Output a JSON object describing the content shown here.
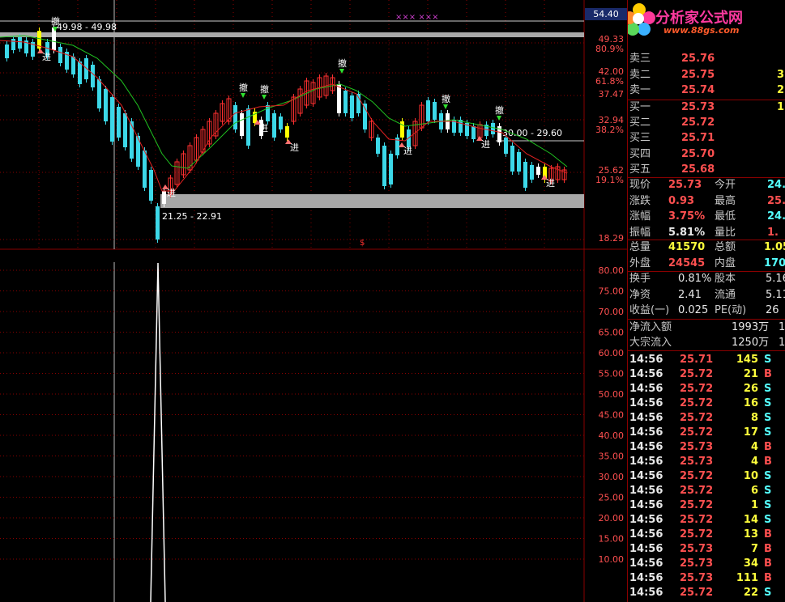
{
  "colors": {
    "up": "#ff3030",
    "down": "#3cd8e8",
    "flat": "#ffffff",
    "grid": "#8a0000",
    "ma_green": "#20c020",
    "ma_red": "#e02020",
    "band": "#a8a8a8",
    "axis_text": "#ff5050",
    "highlight": "#ffff00"
  },
  "header": {
    "tag_value": "54.40"
  },
  "price_axis": {
    "labels": [
      "49.33",
      "80.9%",
      "42.00",
      "61.8%",
      "37.47",
      "32.94",
      "38.2%",
      "25.62",
      "19.1%",
      "18.29"
    ]
  },
  "indicator_axis": {
    "labels": [
      "80.00",
      "75.00",
      "70.00",
      "65.00",
      "60.00",
      "55.00",
      "50.00",
      "45.00",
      "40.00",
      "35.00",
      "30.00",
      "25.00",
      "20.00",
      "15.00",
      "10.00"
    ]
  },
  "bands": {
    "upper": "49.98 - 49.98",
    "middle": "30.00 - 29.60",
    "lower": "21.25 - 22.91"
  },
  "chart_labels": {
    "buy": "进",
    "cancel": "撤",
    "top_marks": "××× ×××",
    "dollar": "$"
  },
  "logo": {
    "text": "分析家公式网",
    "url": "www.88gs.com"
  },
  "quote": {
    "asks": [
      {
        "label": "卖三",
        "price": "25.76",
        "vol": ""
      },
      {
        "label": "卖二",
        "price": "25.75",
        "vol": "3"
      },
      {
        "label": "卖一",
        "price": "25.74",
        "vol": "2"
      }
    ],
    "bids": [
      {
        "label": "买一",
        "price": "25.73",
        "vol": "1"
      },
      {
        "label": "买二",
        "price": "25.72",
        "vol": ""
      },
      {
        "label": "买三",
        "price": "25.71",
        "vol": ""
      },
      {
        "label": "买四",
        "price": "25.70",
        "vol": ""
      },
      {
        "label": "买五",
        "price": "25.68",
        "vol": ""
      }
    ],
    "stats": [
      {
        "l1": "现价",
        "v1": "25.73",
        "c1": "red",
        "l2": "今开",
        "v2": "24.",
        "c2": "cyan"
      },
      {
        "l1": "涨跌",
        "v1": "0.93",
        "c1": "red",
        "l2": "最高",
        "v2": "25.",
        "c2": "red"
      },
      {
        "l1": "涨幅",
        "v1": "3.75%",
        "c1": "red",
        "l2": "最低",
        "v2": "24.",
        "c2": "cyan"
      },
      {
        "l1": "振幅",
        "v1": "5.81%",
        "c1": "white",
        "l2": "量比",
        "v2": "1.",
        "c2": "red"
      }
    ],
    "vol": [
      {
        "l1": "总量",
        "v1": "41570",
        "c1": "yellow",
        "l2": "总额",
        "v2": "1.05",
        "c2": "yellow"
      },
      {
        "l1": "外盘",
        "v1": "24545",
        "c1": "red",
        "l2": "内盘",
        "v2": "170",
        "c2": "cyan"
      }
    ],
    "fund": [
      {
        "l1": "换手",
        "v1": "0.81%",
        "c1": "white",
        "l2": "股本",
        "v2": "5.16",
        "c2": "white"
      },
      {
        "l1": "净资",
        "v1": "2.41",
        "c1": "white",
        "l2": "流通",
        "v2": "5.11",
        "c2": "white"
      },
      {
        "l1": "收益(一)",
        "v1": "0.025",
        "c1": "white",
        "l2": "PE(动)",
        "v2": "26",
        "c2": "white"
      }
    ],
    "flow": [
      {
        "label": "净流入额",
        "value": "1993万",
        "extra": "1"
      },
      {
        "label": "大宗流入",
        "value": "1250万",
        "extra": "1"
      }
    ]
  },
  "ticks": [
    {
      "time": "14:56",
      "price": "25.71",
      "pc": "red",
      "vol": "145",
      "side": "S"
    },
    {
      "time": "14:56",
      "price": "25.72",
      "pc": "red",
      "vol": "21",
      "side": "B"
    },
    {
      "time": "14:56",
      "price": "25.72",
      "pc": "red",
      "vol": "26",
      "side": "S"
    },
    {
      "time": "14:56",
      "price": "25.72",
      "pc": "red",
      "vol": "16",
      "side": "S"
    },
    {
      "time": "14:56",
      "price": "25.72",
      "pc": "red",
      "vol": "8",
      "side": "S"
    },
    {
      "time": "14:56",
      "price": "25.72",
      "pc": "red",
      "vol": "17",
      "side": "S"
    },
    {
      "time": "14:56",
      "price": "25.73",
      "pc": "red",
      "vol": "4",
      "side": "B"
    },
    {
      "time": "14:56",
      "price": "25.73",
      "pc": "red",
      "vol": "4",
      "side": "B"
    },
    {
      "time": "14:56",
      "price": "25.72",
      "pc": "red",
      "vol": "10",
      "side": "S"
    },
    {
      "time": "14:56",
      "price": "25.72",
      "pc": "red",
      "vol": "6",
      "side": "S"
    },
    {
      "time": "14:56",
      "price": "25.72",
      "pc": "red",
      "vol": "1",
      "side": "S"
    },
    {
      "time": "14:56",
      "price": "25.72",
      "pc": "red",
      "vol": "14",
      "side": "S"
    },
    {
      "time": "14:56",
      "price": "25.72",
      "pc": "red",
      "vol": "13",
      "side": "B"
    },
    {
      "time": "14:56",
      "price": "25.73",
      "pc": "red",
      "vol": "7",
      "side": "B"
    },
    {
      "time": "14:56",
      "price": "25.73",
      "pc": "red",
      "vol": "34",
      "side": "B"
    },
    {
      "time": "14:56",
      "price": "25.73",
      "pc": "red",
      "vol": "111",
      "side": "B"
    },
    {
      "time": "14:56",
      "price": "25.72",
      "pc": "red",
      "vol": "22",
      "side": "S"
    }
  ]
}
